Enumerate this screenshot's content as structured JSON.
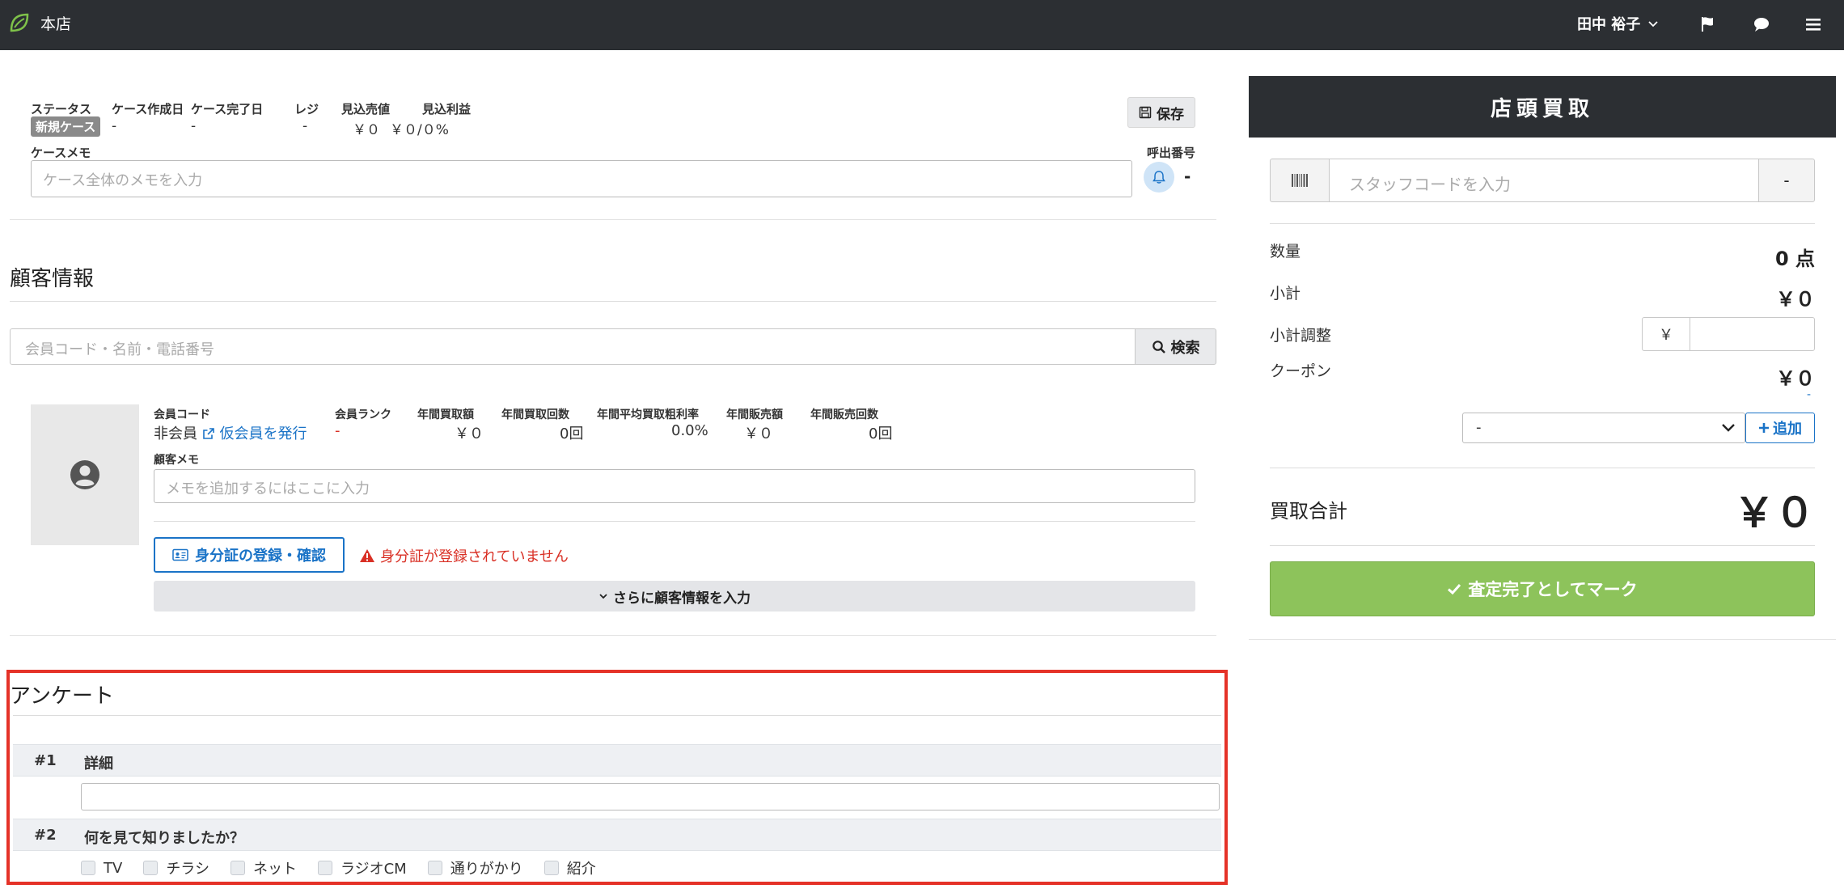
{
  "navbar": {
    "store": "本店",
    "user": "田中 裕子"
  },
  "case": {
    "labels": {
      "status": "ステータス",
      "created": "ケース作成日",
      "completed": "ケース完了日",
      "register": "レジ",
      "expected_sales": "見込売値",
      "expected_profit": "見込利益"
    },
    "status_badge": "新規ケース",
    "values": {
      "created": "-",
      "completed": "-",
      "register": "-",
      "expected_sales": "￥０",
      "expected_profit": "￥０/０%"
    },
    "memo_label": "ケースメモ",
    "memo_placeholder": "ケース全体のメモを入力",
    "save_label": "保存",
    "call_label": "呼出番号",
    "call_number": "-"
  },
  "customer": {
    "section_title": "顧客情報",
    "search_placeholder": "会員コード・名前・電話番号",
    "search_label": "検索",
    "labels": {
      "code": "会員コード",
      "rank": "会員ランク",
      "annual_buy_amount": "年間買取額",
      "annual_buy_count": "年間買取回数",
      "annual_margin": "年間平均買取粗利率",
      "annual_sales_amount": "年間販売額",
      "annual_sales_count": "年間販売回数"
    },
    "values": {
      "code": "非会員",
      "issue_link": "仮会員を発行",
      "rank": "-",
      "annual_buy_amount": "￥０",
      "annual_buy_count": "0回",
      "annual_margin": "0.0%",
      "annual_sales_amount": "￥０",
      "annual_sales_count": "0回"
    },
    "memo_label": "顧客メモ",
    "memo_placeholder": "メモを追加するにはここに入力",
    "id_button": "身分証の登録・確認",
    "id_warning": "身分証が登録されていません",
    "more_button": "さらに顧客情報を入力"
  },
  "survey": {
    "section_title": "アンケート",
    "questions": [
      {
        "num": "#1",
        "text": "詳細"
      },
      {
        "num": "#2",
        "text": "何を見て知りましたか？"
      }
    ],
    "options": [
      "TV",
      "チラシ",
      "ネット",
      "ラジオCM",
      "通りがかり",
      "紹介"
    ]
  },
  "purchase": {
    "title": "店頭買取",
    "staff_placeholder": "スタッフコードを入力",
    "staff_button": "-",
    "quantity_label": "数量",
    "quantity_value": "0 点",
    "subtotal_label": "小計",
    "subtotal_value": "￥０",
    "adjust_label": "小計調整",
    "adjust_currency": "￥",
    "coupon_label": "クーポン",
    "coupon_value": "￥０",
    "coupon_dash": "-",
    "coupon_select": "-",
    "add_label": "追加",
    "total_label": "買取合計",
    "total_value": "￥０",
    "done_label": "査定完了としてマーク"
  },
  "colors": {
    "navbar": "#2c2f33",
    "accent": "#1a73c7",
    "success": "#8dc35b",
    "danger": "#d93025",
    "highlight_frame": "#e53228"
  }
}
